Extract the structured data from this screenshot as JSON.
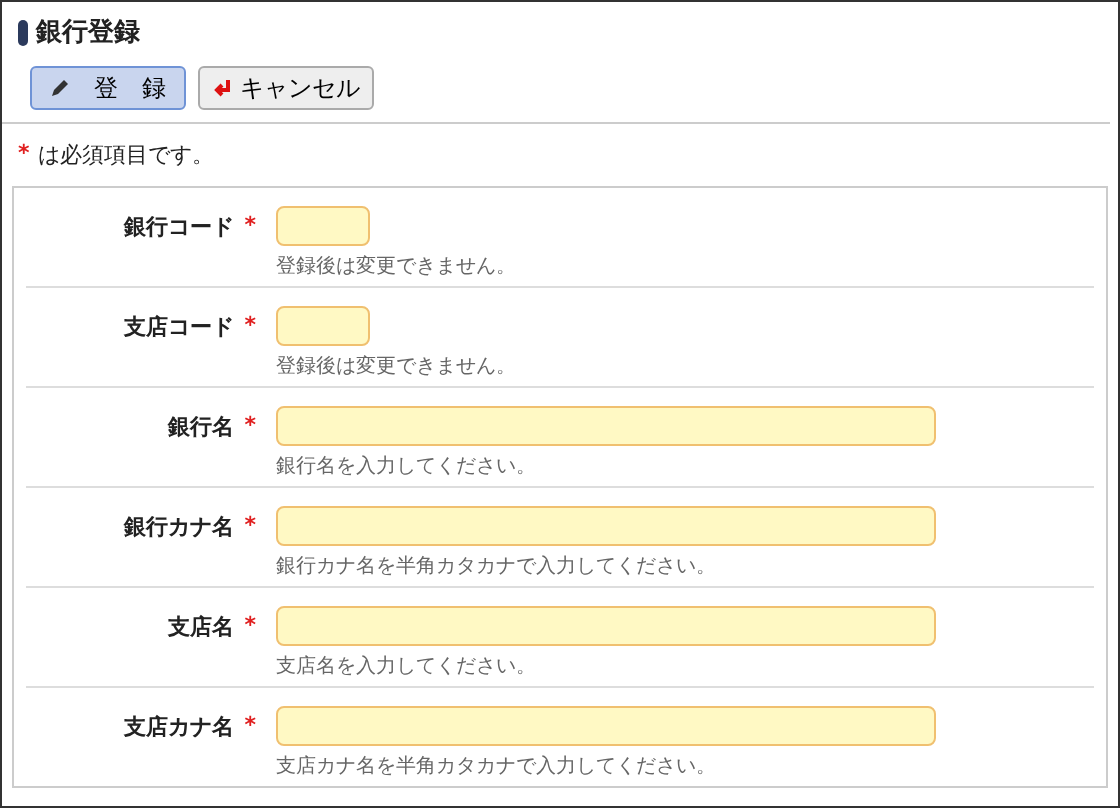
{
  "title": "銀行登録",
  "buttons": [
    {
      "label": "登　録",
      "kind": "primary"
    },
    {
      "label": "キャンセル",
      "kind": "cancel"
    }
  ],
  "note": {
    "mark": "*",
    "text": "は必須項目です。"
  },
  "fields": [
    {
      "label": "銀行コード",
      "mark": "*",
      "kind": "short",
      "hint": "登録後は変更できません。"
    },
    {
      "label": "支店コード",
      "mark": "*",
      "kind": "short",
      "hint": "登録後は変更できません。"
    },
    {
      "label": "銀行名",
      "mark": "*",
      "kind": "long",
      "hint": "銀行名を入力してください。"
    },
    {
      "label": "銀行カナ名",
      "mark": "*",
      "kind": "long",
      "hint": "銀行カナ名を半角カタカナで入力してください。"
    },
    {
      "label": "支店名",
      "mark": "*",
      "kind": "long",
      "hint": "支店名を入力してください。"
    },
    {
      "label": "支店カナ名",
      "mark": "*",
      "kind": "long",
      "hint": "支店カナ名を半角カタカナで入力してください。"
    }
  ]
}
